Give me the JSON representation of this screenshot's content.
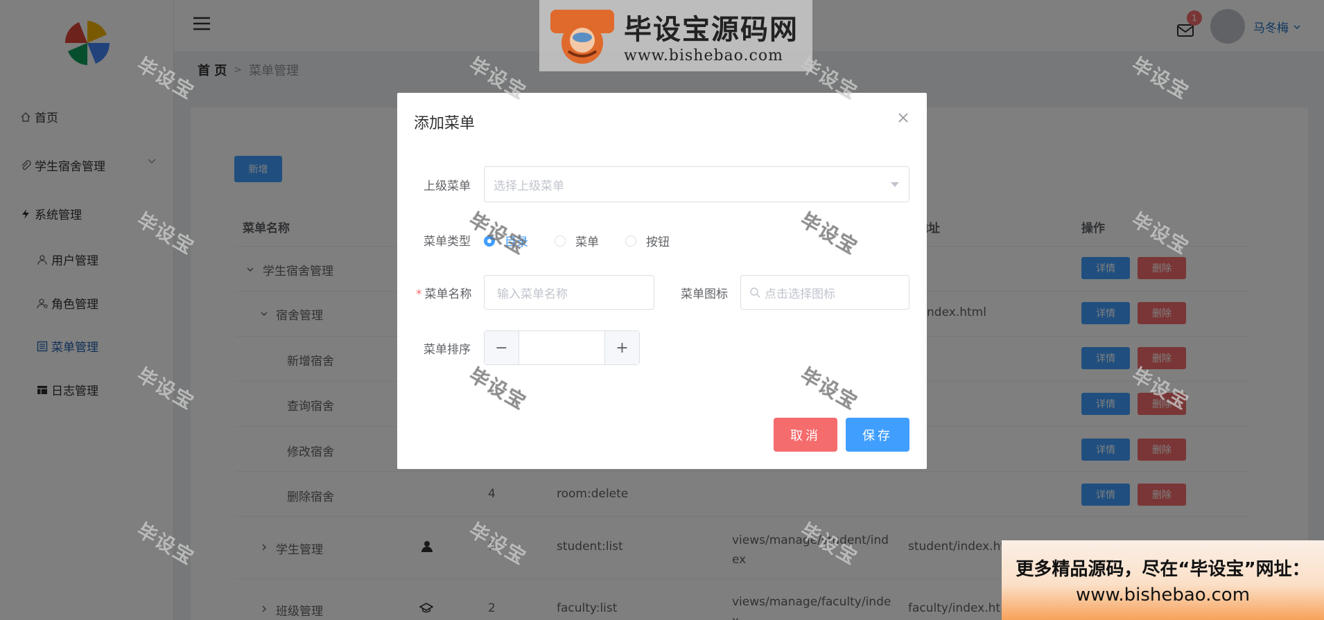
{
  "sidebar": {
    "items": [
      {
        "label": "首页"
      },
      {
        "label": "学生宿舍管理"
      },
      {
        "label": "系统管理"
      },
      {
        "label": "用户管理"
      },
      {
        "label": "角色管理"
      },
      {
        "label": "菜单管理"
      },
      {
        "label": "日志管理"
      }
    ]
  },
  "header": {
    "notification_count": "1",
    "username": "马冬梅"
  },
  "breadcrumb": {
    "home": "首 页",
    "current": "菜单管理"
  },
  "toolbar": {
    "add_label": "新增"
  },
  "table": {
    "headers": {
      "name": "菜单名称",
      "address": "地址",
      "actions": "操作"
    },
    "rows": [
      {
        "name": "学生宿舍管理",
        "order": "",
        "perm": "",
        "route": "",
        "address": ""
      },
      {
        "name": "宿舍管理",
        "order": "",
        "perm": "",
        "route": "",
        "address": "m/index.html"
      },
      {
        "name": "新增宿舍",
        "order": "",
        "perm": "",
        "route": "",
        "address": ""
      },
      {
        "name": "查询宿舍",
        "order": "",
        "perm": "",
        "route": "",
        "address": ""
      },
      {
        "name": "修改宿舍",
        "order": "",
        "perm": "",
        "route": "",
        "address": ""
      },
      {
        "name": "删除宿舍",
        "order": "4",
        "perm": "room:delete",
        "route": "",
        "address": ""
      },
      {
        "name": "学生管理",
        "order": "1",
        "perm": "student:list",
        "route": "views/manage/student/index",
        "address": "student/index.html"
      },
      {
        "name": "班级管理",
        "order": "2",
        "perm": "faculty:list",
        "route": "views/manage/faculty/index",
        "address": "faculty/index.ht"
      }
    ],
    "detail_label": "详情",
    "delete_label": "删除"
  },
  "dialog": {
    "title": "添加菜单",
    "parent_label": "上级菜单",
    "parent_placeholder": "选择上级菜单",
    "type_label": "菜单类型",
    "type_options": [
      "目录",
      "菜单",
      "按钮"
    ],
    "type_selected": "目录",
    "name_label": "菜单名称",
    "name_placeholder": "输入菜单名称",
    "icon_label": "菜单图标",
    "icon_placeholder": "点击选择图标",
    "order_label": "菜单排序",
    "order_value": "",
    "cancel_label": "取消",
    "save_label": "保存"
  },
  "watermark": {
    "text": "毕设宝",
    "banner_title": "毕设宝源码网",
    "banner_url": "www.bishebao.com",
    "bottom_line1": "更多精品源码，尽在“毕设宝”网址：",
    "bottom_line2": "www.bishebao.com"
  },
  "colors": {
    "primary": "#409eff",
    "danger": "#f56c6c",
    "active_menu": "#1f5fae"
  }
}
